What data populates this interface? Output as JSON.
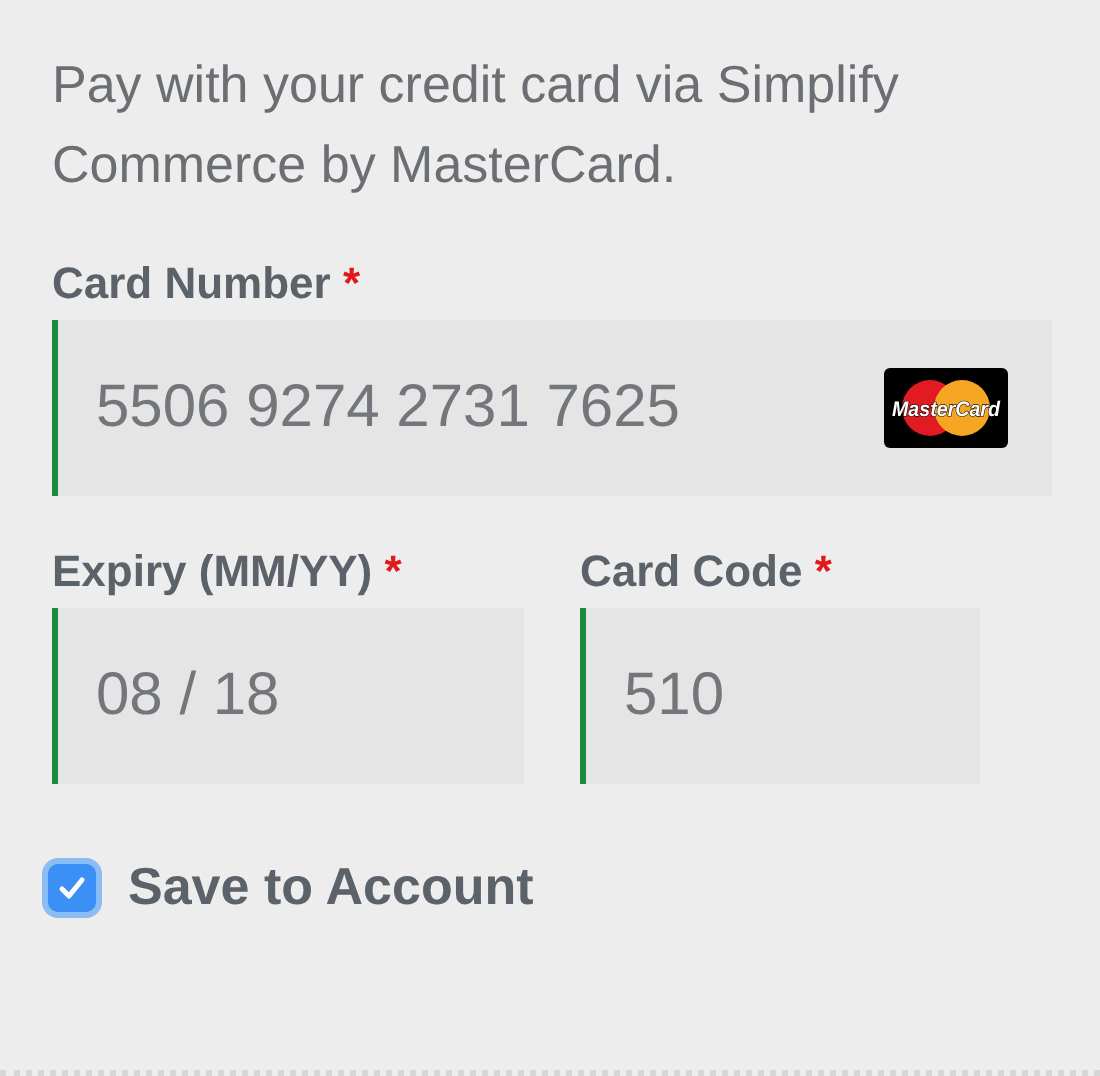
{
  "intro": "Pay with your credit card via Simplify Commerce by MasterCard.",
  "card_number": {
    "label": "Card Number",
    "required_mark": "*",
    "value": "5506 9274 2731 7625",
    "brand": "MasterCard"
  },
  "fields": [
    {
      "label": "Expiry (MM/YY)",
      "required_mark": "*",
      "value": "08 / 18"
    },
    {
      "label": "Card Code",
      "required_mark": "*",
      "value": "510"
    }
  ],
  "save": {
    "label": "Save to Account",
    "checked": true
  }
}
